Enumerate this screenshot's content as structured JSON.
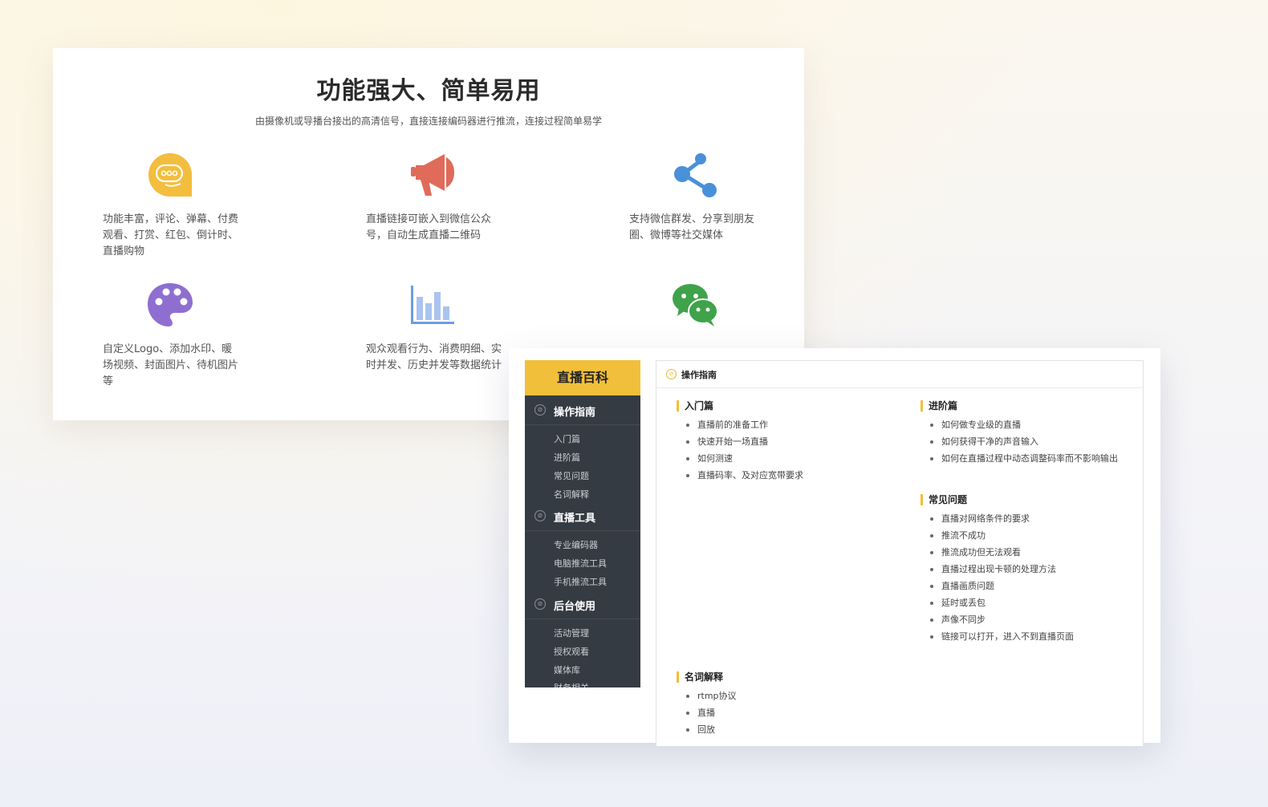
{
  "top_card": {
    "title": "功能强大、简单易用",
    "subtitle": "由摄像机或导播台接出的高清信号，直接连接编码器进行推流，连接过程简单易学",
    "features": [
      {
        "icon": "chat-bubble-icon",
        "text": "功能丰富，评论、弹幕、付费观看、打赏、红包、倒计时、直播购物",
        "color": "#f3bd3e"
      },
      {
        "icon": "megaphone-icon",
        "text": "直播链接可嵌入到微信公众号，自动生成直播二维码",
        "color": "#e06b5a"
      },
      {
        "icon": "share-icon",
        "text": "支持微信群发、分享到朋友圈、微博等社交媒体",
        "color": "#4a90d9"
      },
      {
        "icon": "palette-icon",
        "text": "自定义Logo、添加水印、暖场视频、封面图片、待机图片等",
        "color": "#8e6fd1"
      },
      {
        "icon": "bar-chart-icon",
        "text": "观众观看行为、消费明细、实时并发、历史并发等数据统计",
        "color": "#6f9be0"
      },
      {
        "icon": "wechat-icon",
        "text": "",
        "color": "#3ea34a"
      }
    ]
  },
  "wiki": {
    "header": "直播百科",
    "sections": [
      {
        "label": "操作指南",
        "items": [
          "入门篇",
          "进阶篇",
          "常见问题",
          "名词解释"
        ]
      },
      {
        "label": "直播工具",
        "items": [
          "专业编码器",
          "电脑推流工具",
          "手机推流工具"
        ]
      },
      {
        "label": "后台使用",
        "items": [
          "活动管理",
          "授权观看",
          "媒体库",
          "财务相关"
        ]
      }
    ],
    "main_title": "操作指南",
    "groups": [
      {
        "title": "入门篇",
        "items": [
          "直播前的准备工作",
          "快速开始一场直播",
          "如何测速",
          "直播码率、及对应宽带要求"
        ]
      },
      {
        "title": "进阶篇",
        "items": [
          "如何做专业级的直播",
          "如何获得干净的声音输入",
          "如何在直播过程中动态调整码率而不影响输出"
        ]
      },
      {
        "title": "常见问题",
        "items": [
          "直播对网络条件的要求",
          "推流不成功",
          "推流成功但无法观看",
          "直播过程出现卡顿的处理方法",
          "直播画质问题",
          "延时或丢包",
          "声像不同步",
          "链接可以打开，进入不到直播页面"
        ]
      },
      {
        "title": "名词解释",
        "items": [
          "rtmp协议",
          "直播",
          "回放"
        ]
      }
    ],
    "accent": "#f2bf3a"
  }
}
